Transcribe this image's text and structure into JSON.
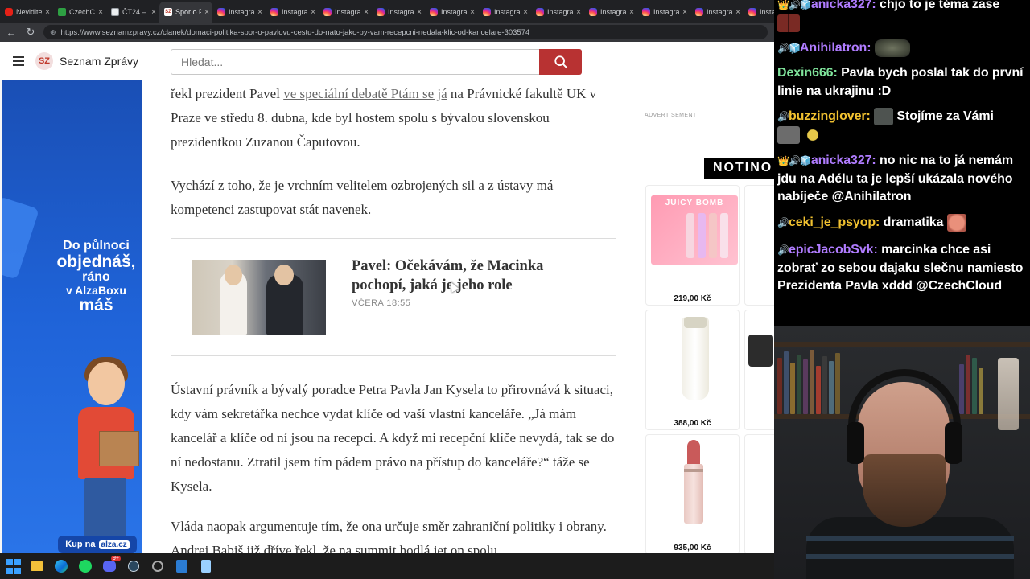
{
  "browser": {
    "tabs": [
      {
        "title": "Neviditel",
        "favicon": "youtube-icon",
        "active": false
      },
      {
        "title": "CzechCl",
        "favicon": "czechcloud-icon",
        "active": false
      },
      {
        "title": "ČT24 –",
        "favicon": "ct24-icon",
        "active": false
      },
      {
        "title": "Spor o P",
        "favicon": "seznam-icon",
        "active": true
      },
      {
        "title": "Instagra",
        "favicon": "instagram-icon",
        "active": false
      },
      {
        "title": "Instagra",
        "favicon": "instagram-icon",
        "active": false
      },
      {
        "title": "Instagra",
        "favicon": "instagram-icon",
        "active": false
      },
      {
        "title": "Instagra",
        "favicon": "instagram-icon",
        "active": false
      },
      {
        "title": "Instagra",
        "favicon": "instagram-icon",
        "active": false
      },
      {
        "title": "Instagra",
        "favicon": "instagram-icon",
        "active": false
      },
      {
        "title": "Instagra",
        "favicon": "instagram-icon",
        "active": false
      },
      {
        "title": "Instagra",
        "favicon": "instagram-icon",
        "active": false
      },
      {
        "title": "Instagra",
        "favicon": "instagram-icon",
        "active": false
      },
      {
        "title": "Instagra",
        "favicon": "instagram-icon",
        "active": false
      },
      {
        "title": "Instagra",
        "favicon": "instagram-icon",
        "active": false
      }
    ],
    "url": "https://www.seznamzpravy.cz/clanek/domaci-politika-spor-o-pavlovu-cestu-do-nato-jako-by-vam-recepcni-nedala-klic-od-kancelare-303574"
  },
  "site": {
    "logo_short": "SZ",
    "logo_name": "Seznam Zprávy",
    "search_placeholder": "Hledat..."
  },
  "article": {
    "p1_start": "řekl prezident Pavel ",
    "p1_link": "ve speciální debatě Ptám se já",
    "p1_end": " na Právnické fakultě UK v Praze ve středu 8. dubna, kde byl hostem spolu s bývalou slovenskou prezidentkou Zuzanou Čaputovou.",
    "p2": "Vychází z toho, že je vrchním velitelem ozbrojených sil a z ústavy má kompetenci zastupovat stát navenek.",
    "related_title": "Pavel: Očekávám, že Macinka pochopí, jaká je jeho role",
    "related_date": "VČERA 18:55",
    "p3": "Ústavní právník a bývalý poradce Petra Pavla Jan Kysela to přirovnává k situaci, kdy vám sekretářka nechce vydat klíče od vaší vlastní kanceláře. „Já mám kancelář a klíče od ní jsou na recepci. A když mi recepční klíče nevydá, tak se do ní nedostanu. Ztratil jsem tím pádem právo na přístup do kanceláře?“ táže se Kysela.",
    "p4": "Vláda naopak argumentuje tím, že ona určuje směr zahraniční politiky i obrany. Andrej Babiš již dříve řekl, že na summit hodlá jet on spolu"
  },
  "ad_left": {
    "line1": "Do půlnoci",
    "line2": "objednáš,",
    "line3": "ráno",
    "line4": "v AlzaBoxu",
    "line5": "máš",
    "cta": "Kup na",
    "brand": "alza.cz"
  },
  "ad_right": {
    "label": "ADVERTISEMENT",
    "brand": "NOTINO",
    "products": [
      {
        "name": "JUICY BOMB",
        "price": "219,00 Kč"
      },
      {
        "name": "",
        "price": "388,00 Kč"
      },
      {
        "name": "",
        "price": "935,00 Kč"
      }
    ]
  },
  "chat": {
    "messages": [
      {
        "user": "anicka327:",
        "text": "chjo to je téma zase",
        "user_color": "#b07cff",
        "badges": "👑🔊🧊"
      },
      {
        "user": "Anihilatron:",
        "text": "",
        "user_color": "#b07cff",
        "badges": "🔊🧊"
      },
      {
        "user": "Dexin666:",
        "text": "Pavla bych poslal tak do první linie na ukrajinu :D",
        "user_color": "#7fe39b",
        "badges": ""
      },
      {
        "user": "buzzinglover:",
        "text": "Stojíme za Vámi",
        "user_color": "#f2c230",
        "badges": "🔊"
      },
      {
        "user": "anicka327:",
        "text": "no nic na to já nemám jdu na Adélu ta je lepší ukázala nového nabíječe @Anihilatron",
        "user_color": "#b07cff",
        "badges": "👑🔊🧊"
      },
      {
        "user": "ceki_je_psyop:",
        "text": "dramatika",
        "user_color": "#f2c230",
        "badges": "🔊"
      },
      {
        "user": "epicJacobSvk:",
        "text": "marcinka chce asi zobrať zo sebou dajaku slečnu namiesto Prezidenta Pavla xddd @CzechCloud",
        "user_color": "#b07cff",
        "badges": "🔊"
      }
    ]
  },
  "taskbar": {
    "apps": [
      "windows-start-icon",
      "file-explorer-icon",
      "edge-browser-icon",
      "spotify-icon",
      "discord-icon",
      "steam-icon",
      "app-icon",
      "word-icon",
      "notepad-icon"
    ],
    "discord_badge": "9+"
  },
  "colors": {
    "accent_red": "#b83232",
    "link_gray": "#666666",
    "alza_blue": "#1f63d8",
    "chat_bg": "#000000"
  }
}
